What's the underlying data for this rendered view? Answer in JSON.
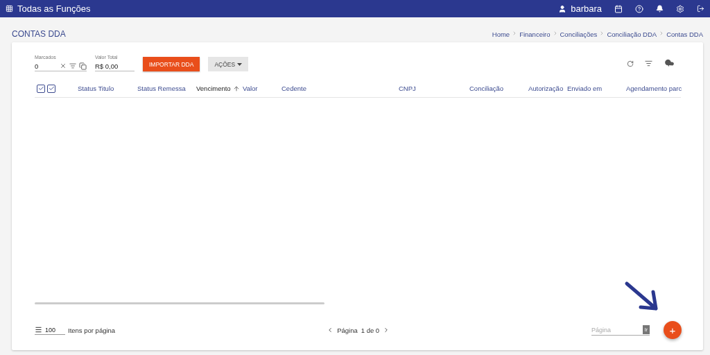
{
  "topbar": {
    "title": "Todas as Funções",
    "user": "barbara"
  },
  "page": {
    "title": "CONTAS DDA",
    "breadcrumb": [
      "Home",
      "Financeiro",
      "Conciliações",
      "Conciliação DDA",
      "Contas DDA"
    ]
  },
  "toolbar": {
    "marked": {
      "label": "Marcados",
      "value": "0"
    },
    "total": {
      "label": "Valor Total",
      "value": "R$ 0,00"
    },
    "import_button": "IMPORTAR DDA",
    "actions_button": "AÇÕES"
  },
  "table": {
    "select_all": [
      {
        "checked": true
      },
      {
        "checked": true
      }
    ],
    "columns": [
      {
        "label": "Status Titulo",
        "sorted": false
      },
      {
        "label": "Status Remessa",
        "sorted": false
      },
      {
        "label": "Vencimento",
        "sorted": true
      },
      {
        "label": "Valor",
        "sorted": false
      },
      {
        "label": "Cedente",
        "sorted": false
      },
      {
        "label": "CNPJ",
        "sorted": false
      },
      {
        "label": "Conciliação",
        "sorted": false
      },
      {
        "label": "Autorização",
        "sorted": false
      },
      {
        "label": "Enviado em",
        "sorted": false
      },
      {
        "label": "Agendamento parc",
        "sorted": false
      }
    ]
  },
  "footer": {
    "page_size": "100",
    "page_size_label": "Itens por página",
    "page_label": "Página",
    "page_info": "1 de 0",
    "goto_placeholder": "Página",
    "goto_button": "Ir",
    "add_button": "+"
  }
}
